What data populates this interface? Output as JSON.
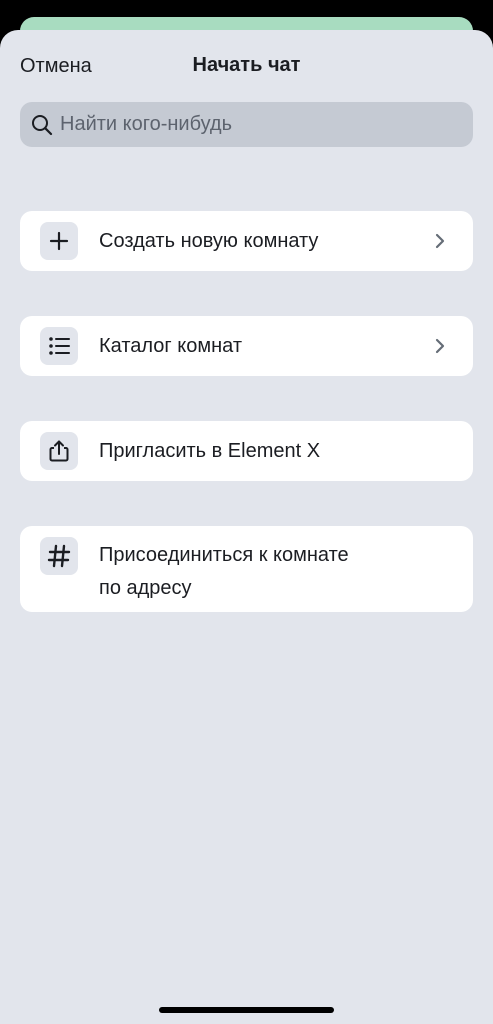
{
  "nav": {
    "cancel_label": "Отмена",
    "title": "Начать чат"
  },
  "search": {
    "placeholder": "Найти кого-нибудь",
    "value": "",
    "icon": "search-icon"
  },
  "items": [
    {
      "label": "Создать новую комнату",
      "icon": "plus-icon",
      "has_chevron": true
    },
    {
      "label": "Каталог комнат",
      "icon": "list-icon",
      "has_chevron": true
    },
    {
      "label": "Пригласить в Element X",
      "icon": "share-icon",
      "has_chevron": false
    },
    {
      "label_line1": "Присоединиться к комнате",
      "label_line2": "по адресу",
      "icon": "hash-icon",
      "has_chevron": false
    }
  ],
  "colors": {
    "sheet_background": "#e2e5ec",
    "card_background": "#ffffff",
    "search_background": "#c5cad3",
    "text_primary": "#1b1d22",
    "chevron": "#656d77"
  }
}
